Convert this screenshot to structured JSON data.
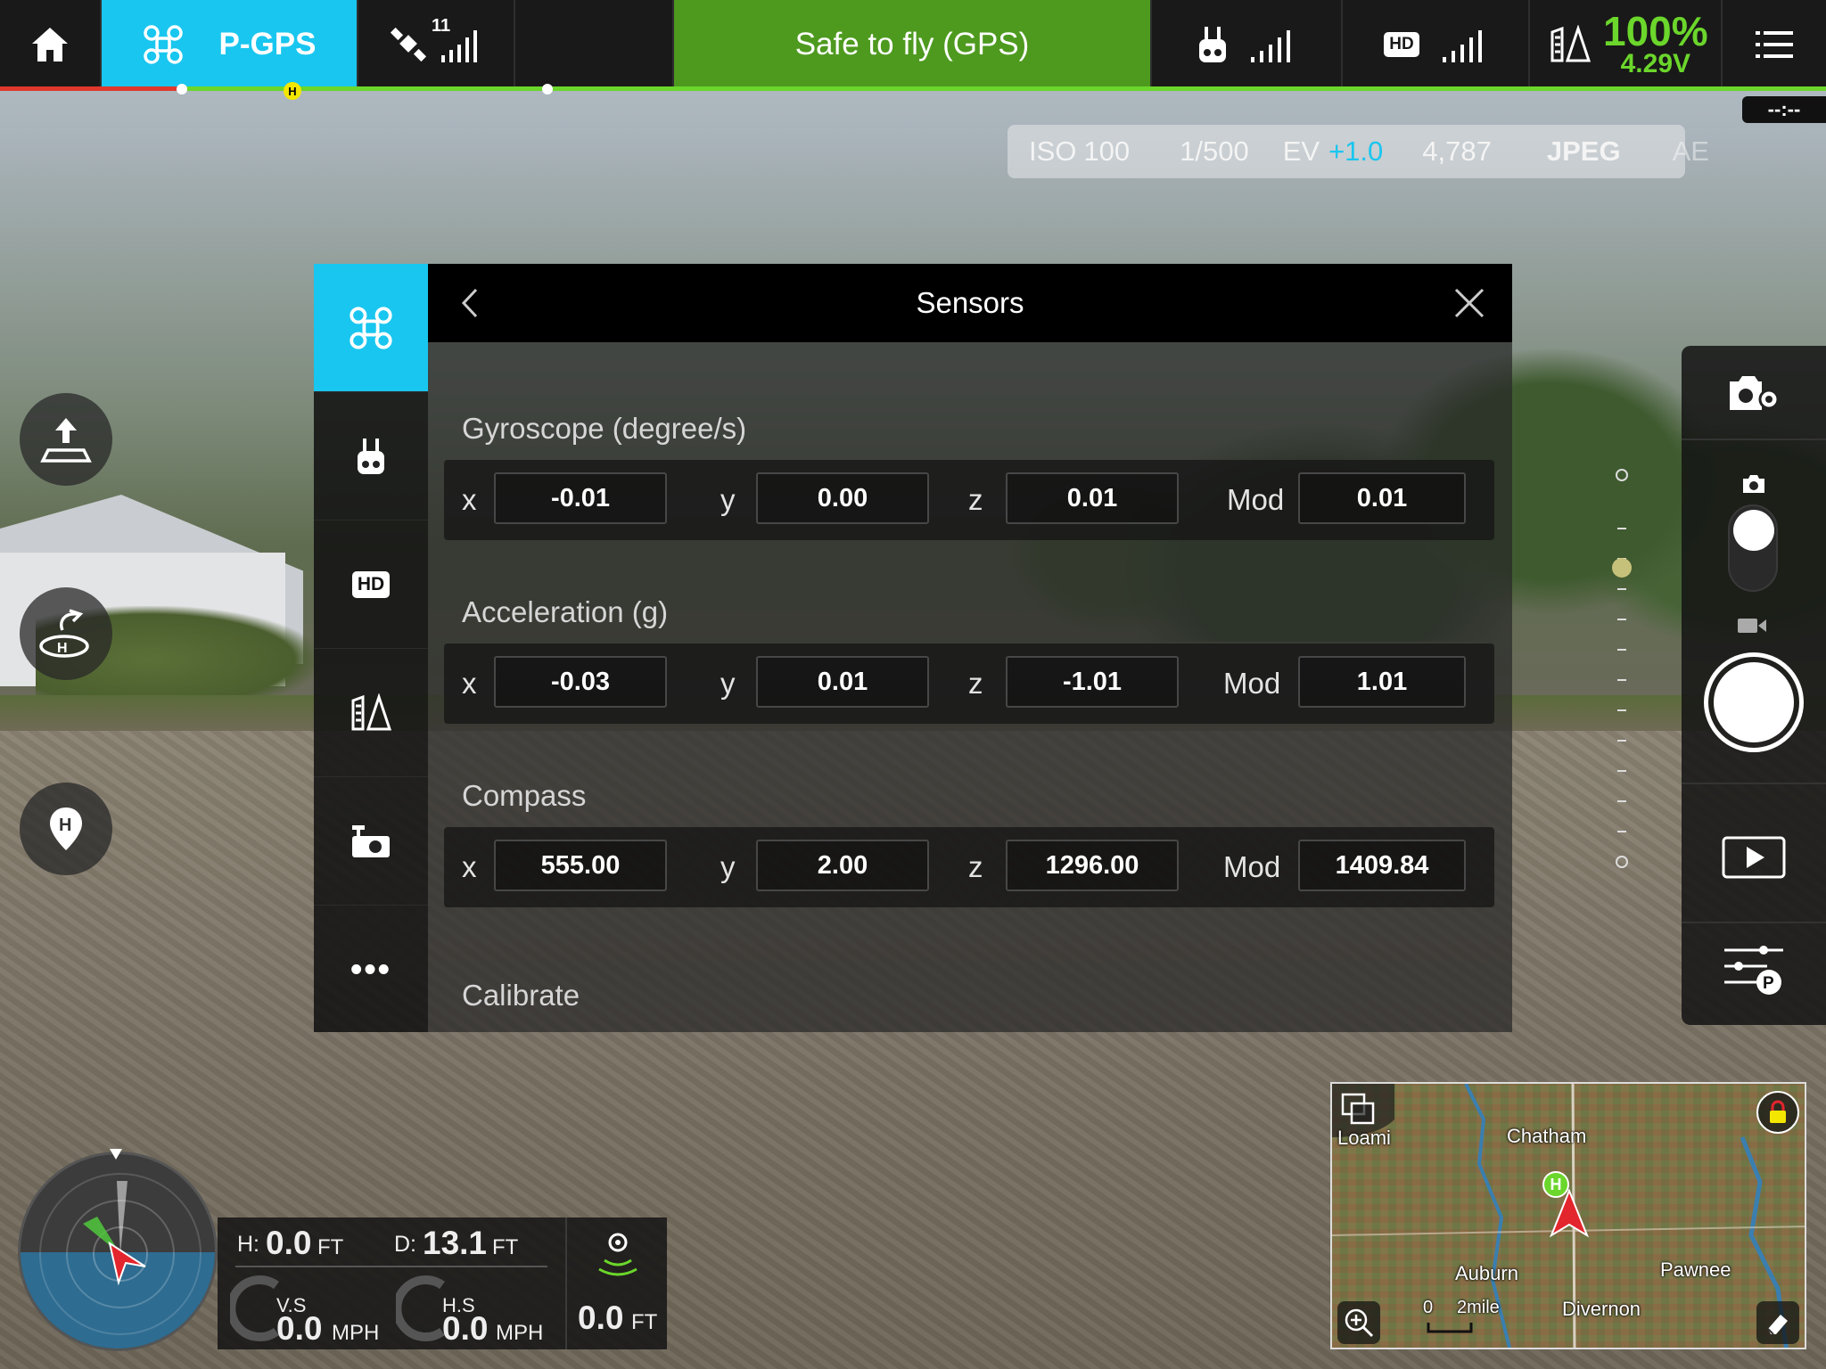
{
  "topbar": {
    "mode": "P-GPS",
    "satellite_count": "11",
    "status": "Safe to fly (GPS)",
    "hd_badge": "HD",
    "battery_percent": "100%",
    "battery_voltage": "4.29V",
    "home_marker": "H",
    "timer": "--:--"
  },
  "camera": {
    "iso_label": "ISO",
    "iso_value": "100",
    "shutter": "1/500",
    "ev_label": "EV",
    "ev_value": "+1.0",
    "capacity": "4,787",
    "format": "JPEG",
    "ae": "AE"
  },
  "sidebar": {
    "hd_label": "HD",
    "more_label": "•••"
  },
  "dialog": {
    "title": "Sensors",
    "gyro": {
      "title": "Gyroscope (degree/s)",
      "x": "-0.01",
      "y": "0.00",
      "z": "0.01",
      "mod": "0.01"
    },
    "accel": {
      "title": "Acceleration (g)",
      "x": "-0.03",
      "y": "0.01",
      "z": "-1.01",
      "mod": "1.01"
    },
    "compass": {
      "title": "Compass",
      "x": "555.00",
      "y": "2.00",
      "z": "1296.00",
      "mod": "1409.84"
    },
    "axis": {
      "x": "x",
      "y": "y",
      "z": "z",
      "mod": "Mod"
    },
    "calibrate": "Calibrate"
  },
  "telemetry": {
    "h_label": "H:",
    "h_value": "0.0",
    "h_unit": "FT",
    "d_label": "D:",
    "d_value": "13.1",
    "d_unit": "FT",
    "vs_label": "V.S",
    "vs_value": "0.0",
    "vs_unit": "MPH",
    "hs_label": "H.S",
    "hs_value": "0.0",
    "hs_unit": "MPH",
    "vps_value": "0.0",
    "vps_unit": "FT"
  },
  "map": {
    "places": [
      "Loami",
      "Chatham",
      "Auburn",
      "Pawnee",
      "Divernon"
    ],
    "scale_zero": "0",
    "scale_label": "2mile",
    "home_marker": "H"
  },
  "colors": {
    "accent": "#19c6ef",
    "status_green": "#4e9a1f",
    "battery_green": "#6bd62b"
  }
}
